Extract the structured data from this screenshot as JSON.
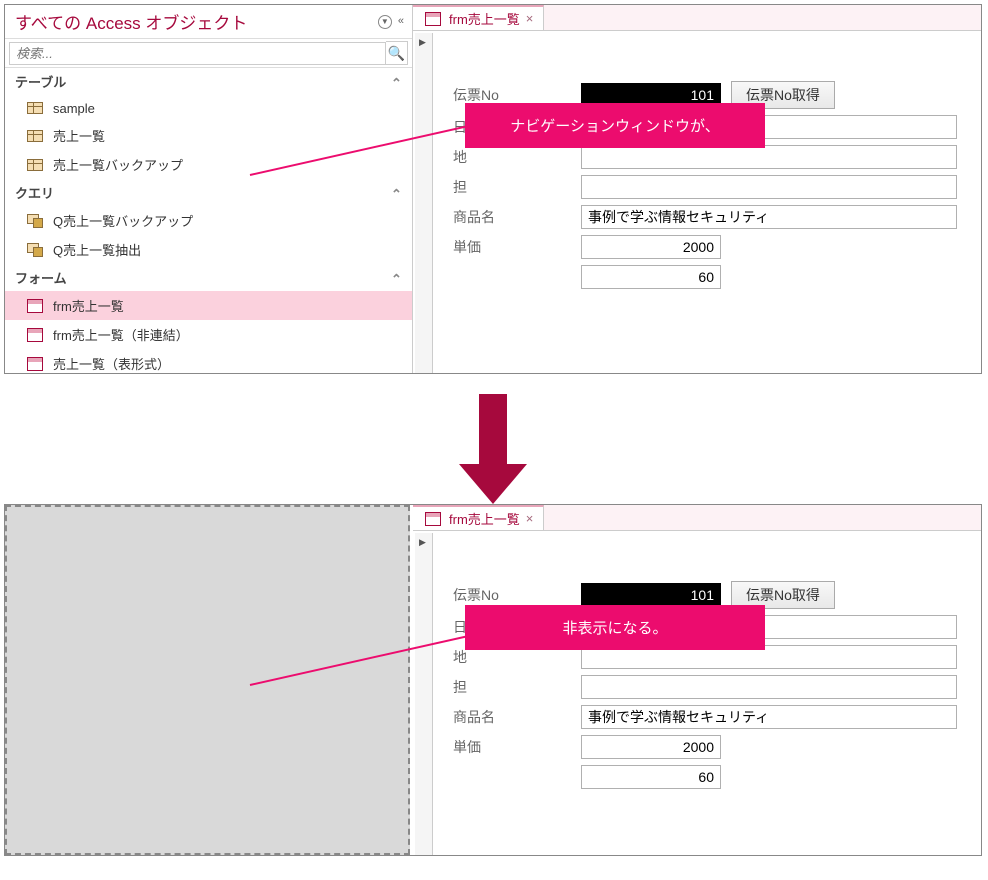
{
  "nav": {
    "title": "すべての Access オブジェクト",
    "search_placeholder": "検索...",
    "groups": {
      "tables": {
        "label": "テーブル",
        "items": [
          "sample",
          "売上一覧",
          "売上一覧バックアップ"
        ]
      },
      "queries": {
        "label": "クエリ",
        "items": [
          "Q売上一覧バックアップ",
          "Q売上一覧抽出"
        ]
      },
      "forms": {
        "label": "フォーム",
        "items": [
          "frm売上一覧",
          "frm売上一覧（非連結）",
          "売上一覧（表形式）"
        ]
      }
    }
  },
  "tab": {
    "label": "frm売上一覧"
  },
  "form": {
    "labels": {
      "denpyo": "伝票No",
      "hi": "日",
      "chi": "地",
      "tan": "担",
      "shohin": "商品名",
      "tanka": "単価"
    },
    "values": {
      "denpyo": "101",
      "shohin": "事例で学ぶ情報セキュリティ",
      "tanka": "2000",
      "qty": "60"
    },
    "button": "伝票No取得"
  },
  "callouts": {
    "top": "ナビゲーションウィンドウが、",
    "bottom": "非表示になる。"
  }
}
